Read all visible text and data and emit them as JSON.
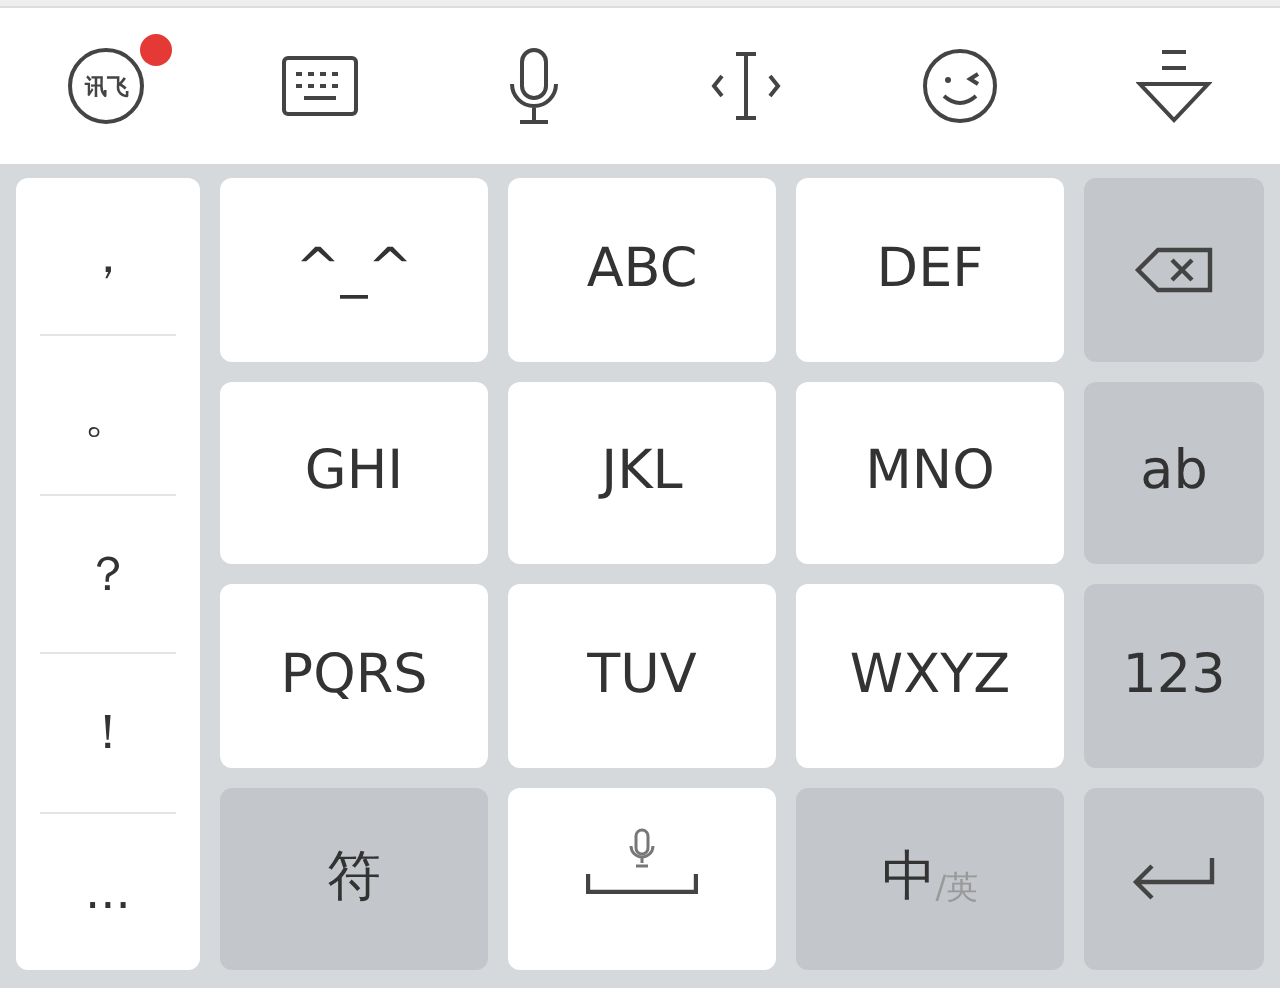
{
  "toolbar": {
    "logo": "讯飞",
    "notification": true,
    "icons": [
      {
        "kind": "keyboard"
      },
      {
        "kind": "microphone"
      },
      {
        "kind": "cursor"
      },
      {
        "kind": "emoji"
      },
      {
        "kind": "collapse"
      }
    ]
  },
  "punctuation": [
    "，",
    "。",
    "？",
    "！",
    "..."
  ],
  "keys": [
    {
      "kind": "letter",
      "label": "^_^"
    },
    {
      "kind": "letter",
      "label": "ABC"
    },
    {
      "kind": "letter",
      "label": "DEF"
    },
    {
      "kind": "backspace"
    },
    {
      "kind": "letter",
      "label": "GHI"
    },
    {
      "kind": "letter",
      "label": "JKL"
    },
    {
      "kind": "letter",
      "label": "MNO"
    },
    {
      "kind": "function",
      "label": "ab"
    },
    {
      "kind": "letter",
      "label": "PQRS"
    },
    {
      "kind": "letter",
      "label": "TUV"
    },
    {
      "kind": "letter",
      "label": "WXYZ"
    },
    {
      "kind": "function",
      "label": "123"
    },
    {
      "kind": "function",
      "label": "符"
    },
    {
      "kind": "space"
    },
    {
      "kind": "lang",
      "label": "中",
      "alt": "/英"
    },
    {
      "kind": "enter"
    }
  ]
}
